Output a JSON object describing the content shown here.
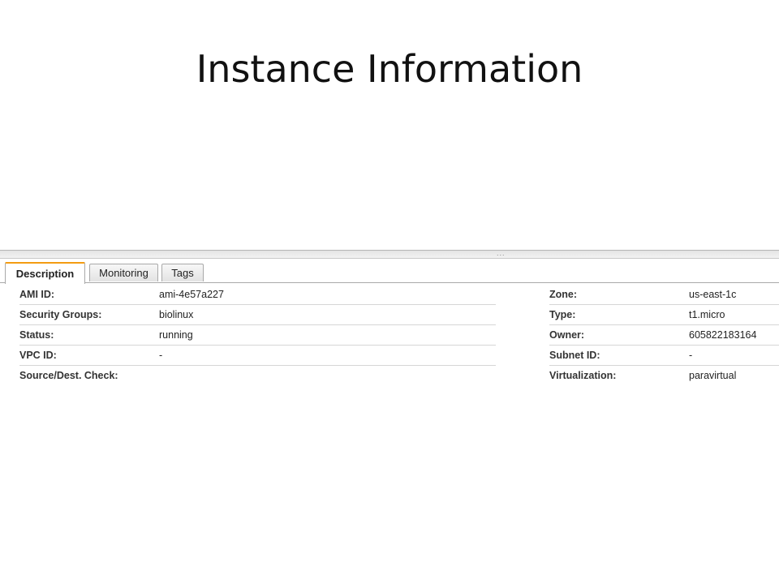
{
  "slide": {
    "title": "Instance Information"
  },
  "splitter": {
    "grip": "..."
  },
  "tabs": [
    {
      "label": "Description",
      "active": true
    },
    {
      "label": "Monitoring",
      "active": false
    },
    {
      "label": "Tags",
      "active": false
    }
  ],
  "description": {
    "left": [
      {
        "label": "AMI ID:",
        "value": "ami-4e57a227"
      },
      {
        "label": "Security Groups:",
        "value": "biolinux"
      },
      {
        "label": "Status:",
        "value": "running"
      },
      {
        "label": "VPC ID:",
        "value": "-"
      },
      {
        "label": "Source/Dest. Check:",
        "value": ""
      }
    ],
    "right": [
      {
        "label": "Zone:",
        "value": "us-east-1c"
      },
      {
        "label": "Type:",
        "value": "t1.micro"
      },
      {
        "label": "Owner:",
        "value": "605822183164"
      },
      {
        "label": "Subnet ID:",
        "value": "-"
      },
      {
        "label": "Virtualization:",
        "value": "paravirtual"
      }
    ]
  },
  "colors": {
    "active_tab_accent": "#f39c12",
    "row_divider": "#d6d6d6"
  }
}
